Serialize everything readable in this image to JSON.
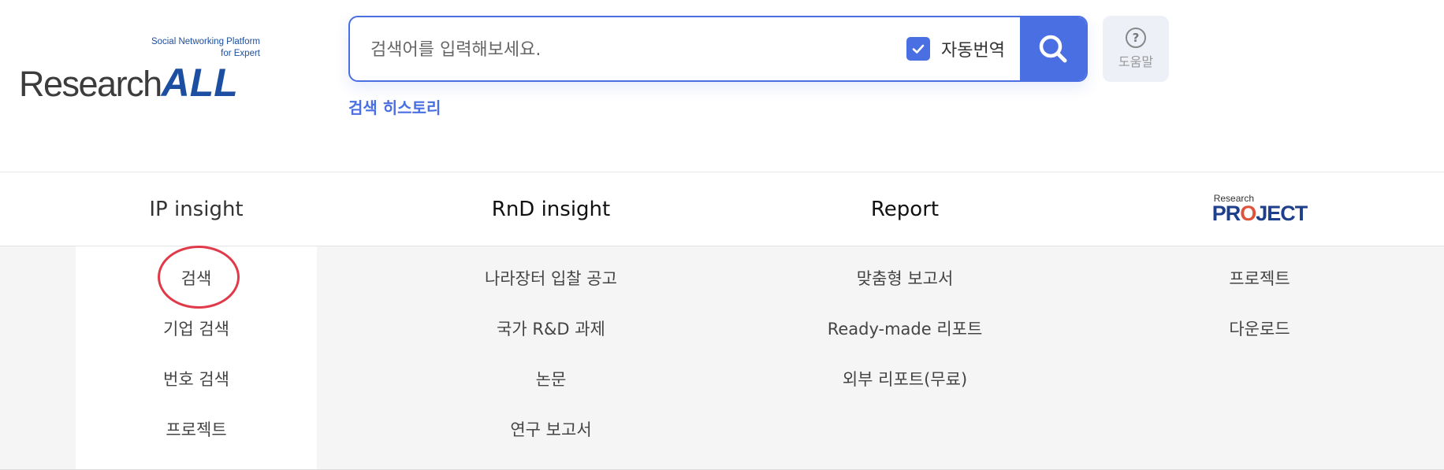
{
  "header": {
    "logo": {
      "tagline_line1": "Social Networking Platform",
      "tagline_line2": "for Expert",
      "word_research": "Research",
      "word_all": "ALL",
      "brand_color": "#1c4fa1"
    },
    "search": {
      "placeholder": "검색어를 입력해보세요.",
      "value": "",
      "auto_translate_label": "자동번역",
      "auto_translate_checked": true,
      "search_button_icon": "search-icon",
      "accent_color": "#4a6fe3"
    },
    "help": {
      "icon": "question-circle-icon",
      "icon_glyph": "?",
      "label": "도움말"
    },
    "history_link": "검색 히스토리"
  },
  "nav": {
    "tabs": [
      {
        "label": "IP insight"
      },
      {
        "label": "RnD insight"
      },
      {
        "label": "Report"
      },
      {
        "label": "Research PROJECT",
        "logo_small": "Research",
        "logo_big_pre": "PR",
        "logo_big_o": "O",
        "logo_big_post": "JECT"
      }
    ]
  },
  "dropdown": {
    "columns": [
      {
        "items": [
          "검색",
          "기업 검색",
          "번호 검색",
          "프로젝트"
        ]
      },
      {
        "items": [
          "나라장터 입찰 공고",
          "국가 R&D 과제",
          "논문",
          "연구 보고서"
        ]
      },
      {
        "items": [
          "맞춤형 보고서",
          "Ready-made 리포트",
          "외부 리포트(무료)"
        ]
      },
      {
        "items": [
          "프로젝트",
          "다운로드"
        ]
      }
    ],
    "highlight_color": "#e03a4a"
  }
}
